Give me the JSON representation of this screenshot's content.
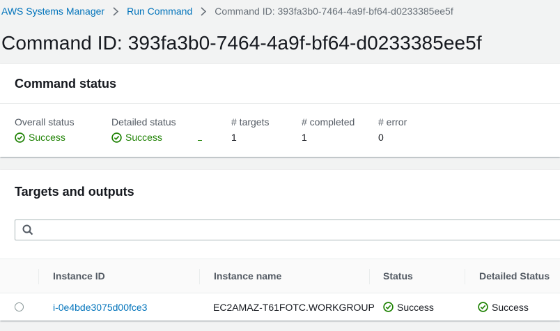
{
  "breadcrumb": {
    "items": [
      "AWS Systems Manager",
      "Run Command"
    ],
    "current": "Command ID: 393fa3b0-7464-4a9f-bf64-d0233385ee5f"
  },
  "page_title": "Command ID: 393fa3b0-7464-4a9f-bf64-d0233385ee5f",
  "command_status": {
    "title": "Command status",
    "overall_status_label": "Overall status",
    "overall_status_value": "Success",
    "detailed_status_label": "Detailed status",
    "detailed_status_value": "Success",
    "targets_label": "# targets",
    "targets_value": "1",
    "completed_label": "# completed",
    "completed_value": "1",
    "error_label": "# error",
    "error_value": "0"
  },
  "targets_outputs": {
    "title": "Targets and outputs",
    "search": {
      "value": "",
      "placeholder": ""
    },
    "columns": [
      "Instance ID",
      "Instance name",
      "Status",
      "Detailed Status"
    ],
    "rows": [
      {
        "instance_id": "i-0e4bde3075d00fce3",
        "instance_name": "EC2AMAZ-T61FOTC.WORKGROUP",
        "status": "Success",
        "detailed_status": "Success"
      }
    ]
  },
  "colors": {
    "link": "#0073bb",
    "success": "#1d8102",
    "background": "#f2f3f3"
  }
}
